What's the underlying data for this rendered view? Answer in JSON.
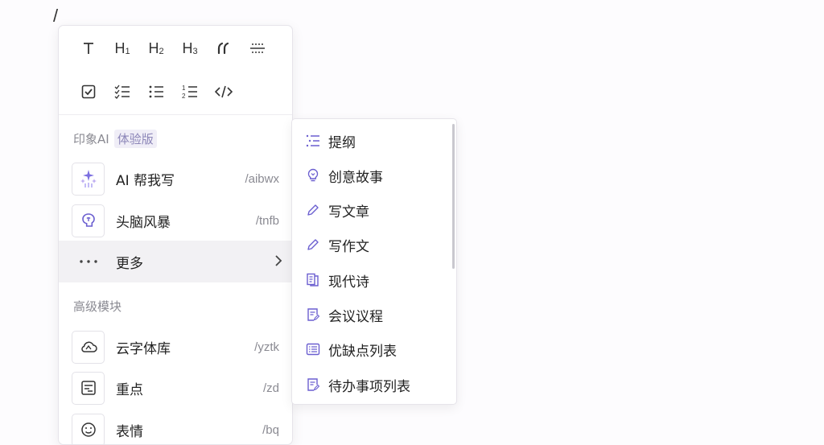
{
  "editor": {
    "slash_char": "/"
  },
  "toolbar": {
    "row1": [
      {
        "icon": "text-icon",
        "label": "T"
      },
      {
        "icon": "heading-1-icon",
        "label": "H",
        "sub": "1"
      },
      {
        "icon": "heading-2-icon",
        "label": "H",
        "sub": "2"
      },
      {
        "icon": "heading-3-icon",
        "label": "H",
        "sub": "3"
      },
      {
        "icon": "quote-icon",
        "label": "“"
      },
      {
        "icon": "divider-icon",
        "label": ""
      }
    ],
    "row2": [
      {
        "icon": "checkbox-icon"
      },
      {
        "icon": "checklist-icon"
      },
      {
        "icon": "bullet-list-icon"
      },
      {
        "icon": "numbered-list-icon"
      },
      {
        "icon": "code-icon"
      }
    ]
  },
  "ai_section": {
    "title": "印象AI",
    "badge": "体验版",
    "items": [
      {
        "icon": "sparkle-icon",
        "label": "AI 帮我写",
        "shortcut": "/aibwx"
      },
      {
        "icon": "brain-icon",
        "label": "头脑风暴",
        "shortcut": "/tnfb"
      },
      {
        "icon": "more-icon",
        "label": "更多",
        "shortcut": ""
      }
    ]
  },
  "advanced_section": {
    "title": "高级模块",
    "items": [
      {
        "icon": "cloud-font-icon",
        "label": "云字体库",
        "shortcut": "/yztk"
      },
      {
        "icon": "highlight-icon",
        "label": "重点",
        "shortcut": "/zd"
      },
      {
        "icon": "emoji-icon",
        "label": "表情",
        "shortcut": "/bq"
      }
    ]
  },
  "submenu": {
    "items": [
      {
        "icon": "outline-icon",
        "label": "提纲"
      },
      {
        "icon": "lightbulb-icon",
        "label": "创意故事"
      },
      {
        "icon": "pencil-icon",
        "label": "写文章"
      },
      {
        "icon": "pencil-icon",
        "label": "写作文"
      },
      {
        "icon": "poem-icon",
        "label": "现代诗"
      },
      {
        "icon": "agenda-icon",
        "label": "会议议程"
      },
      {
        "icon": "pros-cons-icon",
        "label": "优缺点列表"
      },
      {
        "icon": "todo-icon",
        "label": "待办事项列表"
      }
    ]
  },
  "colors": {
    "accent": "#6b5fd0",
    "muted": "#8a8a92",
    "hover": "#f2f1f4"
  }
}
